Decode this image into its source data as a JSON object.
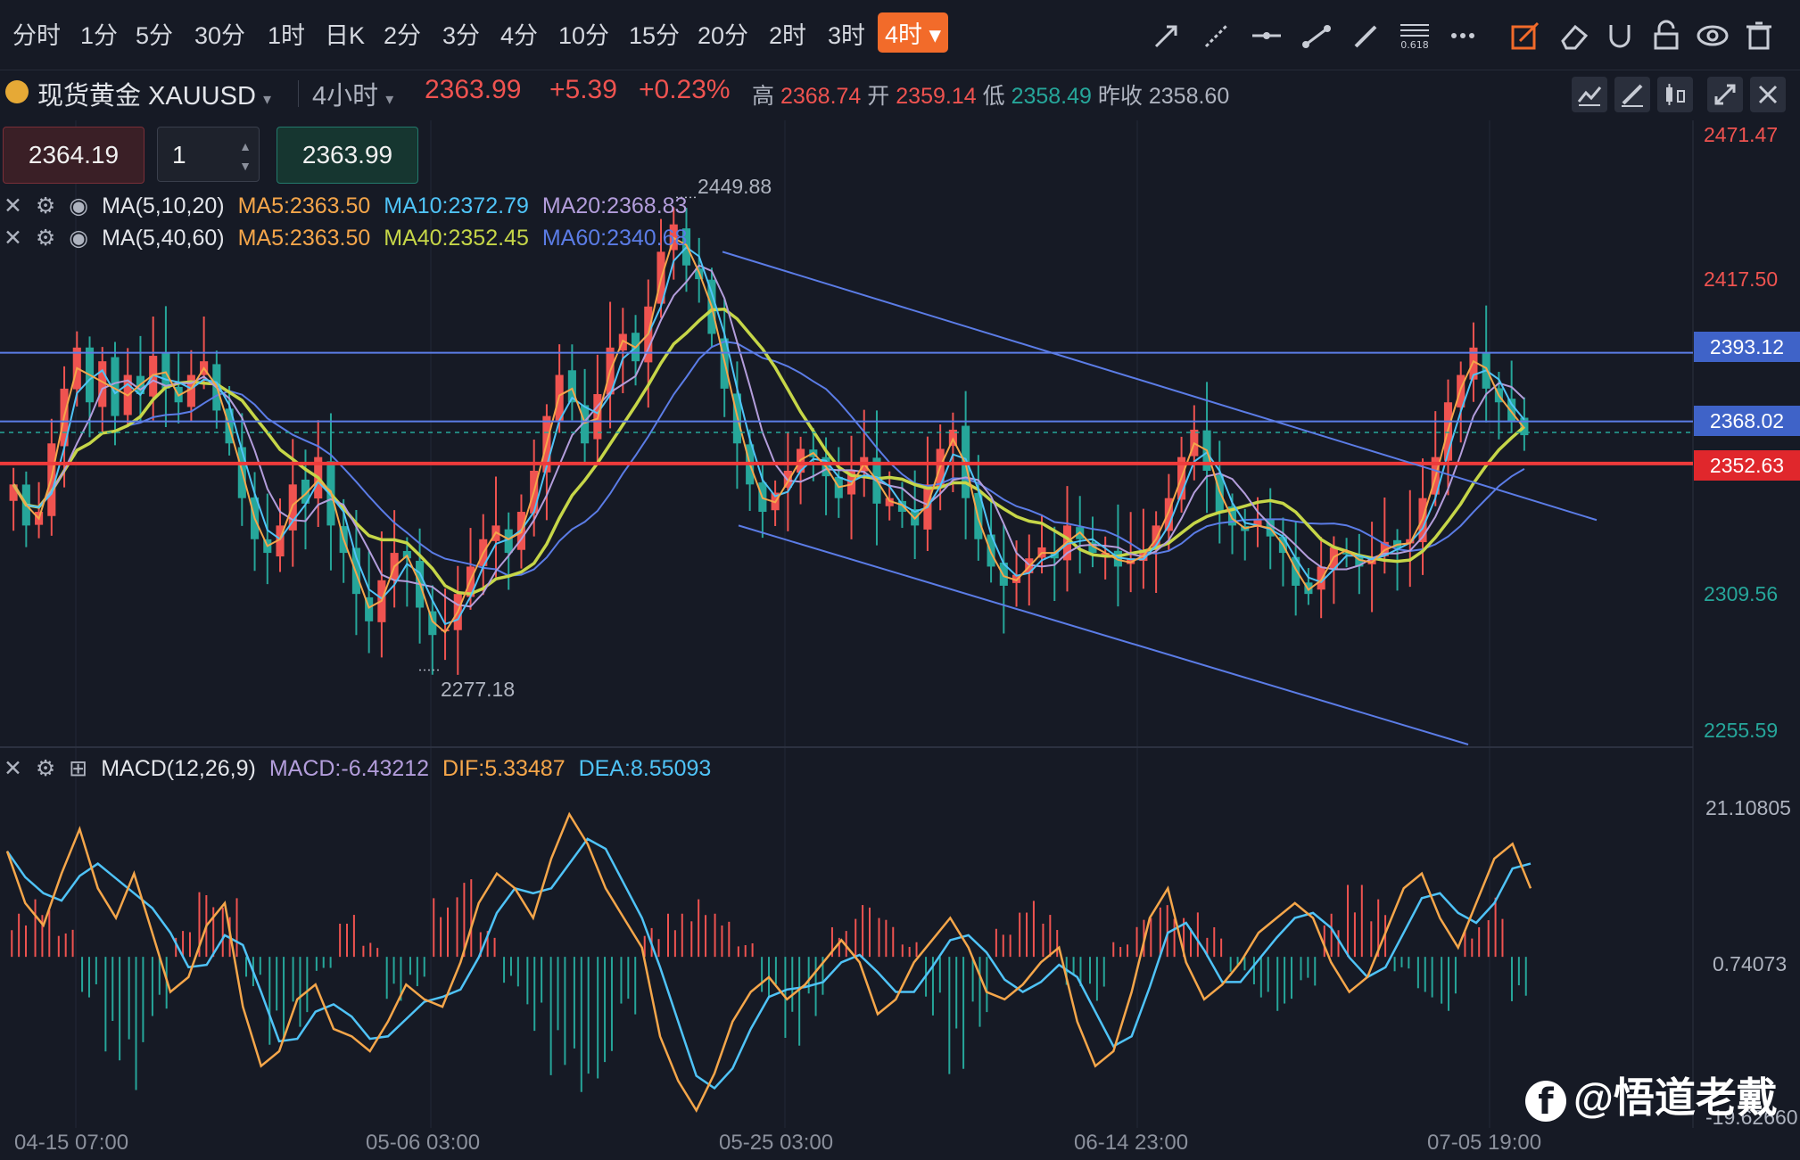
{
  "timeframes": [
    "分时",
    "1分",
    "5分",
    "30分",
    "1时",
    "日K",
    "2分",
    "3分",
    "4分",
    "10分",
    "15分",
    "20分",
    "2时",
    "3时"
  ],
  "active_timeframe": "4时",
  "symbol": {
    "name": "现货黄金 XAUUSD",
    "period": "4小时",
    "last": "2363.99",
    "change": "+5.39",
    "change_pct": "+0.23%",
    "high_label": "高",
    "high": "2368.74",
    "open_label": "开",
    "open": "2359.14",
    "low_label": "低",
    "low": "2358.49",
    "prev_label": "昨收",
    "prev": "2358.60"
  },
  "trade": {
    "sell": "2364.19",
    "qty": "1",
    "buy": "2363.99"
  },
  "indicators": {
    "ma1": {
      "name": "MA(5,10,20)",
      "a": "MA5:2363.50",
      "b": "MA10:2372.79",
      "c": "MA20:2368.83"
    },
    "ma2": {
      "name": "MA(5,40,60)",
      "a": "MA5:2363.50",
      "b": "MA40:2352.45",
      "c": "MA60:2340.68"
    },
    "macd": {
      "name": "MACD(12,26,9)",
      "macd": "MACD:-6.43212",
      "dif": "DIF:5.33487",
      "dea": "DEA:8.55093"
    }
  },
  "price_axis": {
    "ticks": [
      "2471.47",
      "2417.50",
      "2309.56",
      "2255.59"
    ],
    "level_a": "2393.12",
    "level_b": "2368.02",
    "level_c": "2352.63"
  },
  "macd_axis": {
    "ticks": [
      "21.10805",
      "0.74073",
      "-19.62660"
    ]
  },
  "marks": {
    "high": "2449.88",
    "low": "2277.18"
  },
  "x_axis": [
    "04-15 07:00",
    "05-06 03:00",
    "05-25 03:00",
    "06-14 23:00",
    "07-05 19:00"
  ],
  "watermark": "@悟道老戴",
  "colors": {
    "up": "#ef5350",
    "down": "#26a69a",
    "ma5": "#f5a64a",
    "ma10": "#4fc3f7",
    "ma20": "#b39ddb",
    "ma40": "#c6d648",
    "ma60": "#5b7ce6",
    "hline": "#5b7ce6",
    "red_line": "#ef3b3b"
  },
  "chart_data": {
    "type": "candlestick",
    "series_note": "",
    "close": [
      2345,
      2330,
      2335,
      2360,
      2380,
      2395,
      2375,
      2390,
      2370,
      2385,
      2378,
      2392,
      2380,
      2375,
      2385,
      2390,
      2372,
      2360,
      2340,
      2325,
      2320,
      2330,
      2345,
      2338,
      2355,
      2330,
      2320,
      2305,
      2295,
      2310,
      2320,
      2318,
      2300,
      2290,
      2292,
      2305,
      2315,
      2325,
      2330,
      2320,
      2335,
      2350,
      2370,
      2385,
      2375,
      2360,
      2378,
      2395,
      2400,
      2390,
      2410,
      2430,
      2440,
      2425,
      2420,
      2400,
      2380,
      2360,
      2345,
      2335,
      2342,
      2350,
      2358,
      2355,
      2348,
      2340,
      2350,
      2355,
      2338,
      2340,
      2335,
      2330,
      2345,
      2358,
      2365,
      2340,
      2325,
      2315,
      2308,
      2312,
      2318,
      2322,
      2318,
      2330,
      2325,
      2320,
      2320,
      2315,
      2318,
      2320,
      2330,
      2340,
      2355,
      2365,
      2350,
      2335,
      2330,
      2328,
      2332,
      2326,
      2320,
      2308,
      2305,
      2315,
      2322,
      2320,
      2315,
      2318,
      2324,
      2322,
      2325,
      2340,
      2355,
      2375,
      2385,
      2395,
      2380,
      2375,
      2368,
      2363
    ],
    "macd_dif": [
      15,
      8,
      5,
      12,
      18,
      10,
      6,
      12,
      4,
      -4,
      -2,
      5,
      8,
      -6,
      -14,
      -12,
      -5,
      -3,
      -9,
      -10,
      -12,
      -8,
      -3,
      -5,
      -6,
      0,
      8,
      12,
      10,
      6,
      14,
      20,
      16,
      10,
      6,
      2,
      -10,
      -16,
      -20,
      -15,
      -8,
      -4,
      -2,
      -5,
      -3,
      0,
      3,
      0,
      -7,
      -5,
      0,
      3,
      6,
      2,
      -4,
      -5,
      -3,
      0,
      2,
      -8,
      -14,
      -12,
      -4,
      6,
      10,
      0,
      -5,
      -3,
      0,
      4,
      6,
      8,
      6,
      0,
      -4,
      -2,
      4,
      10,
      12,
      6,
      2,
      8,
      14,
      16,
      10
    ],
    "macd_hist": [
      6,
      8,
      4,
      -6,
      -14,
      -18,
      -8,
      4,
      10,
      8,
      -4,
      -12,
      -10,
      -2,
      6,
      2,
      -6,
      -4,
      8,
      12,
      4,
      -4,
      -10,
      -16,
      -20,
      -18,
      -8,
      4,
      6,
      8,
      6,
      2,
      -6,
      -12,
      -8,
      4,
      8,
      6,
      2,
      -8,
      -16,
      -10,
      4,
      8,
      6,
      -4,
      -6,
      2,
      6,
      8,
      6,
      4,
      -2,
      -6,
      -8,
      -4,
      6,
      10,
      8,
      -2,
      -6,
      -8,
      4,
      8,
      -6
    ]
  }
}
